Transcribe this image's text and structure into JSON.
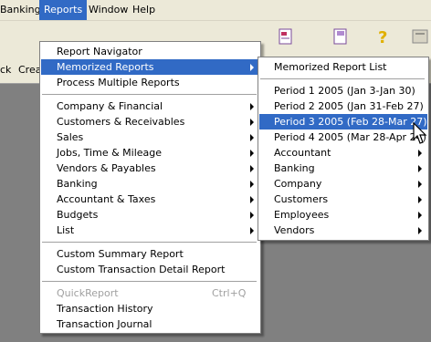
{
  "menubar": {
    "items": [
      {
        "label": "Banking"
      },
      {
        "label": "Reports"
      },
      {
        "label": "Window"
      },
      {
        "label": "Help"
      }
    ]
  },
  "toolbar": {
    "left_text_1": "ck",
    "left_text_2": "Crea"
  },
  "reports_menu": {
    "items": [
      {
        "label": "Report Navigator"
      },
      {
        "label": "Memorized Reports"
      },
      {
        "label": "Process Multiple Reports"
      },
      {
        "label": "Company & Financial"
      },
      {
        "label": "Customers & Receivables"
      },
      {
        "label": "Sales"
      },
      {
        "label": "Jobs, Time & Mileage"
      },
      {
        "label": "Vendors & Payables"
      },
      {
        "label": "Banking"
      },
      {
        "label": "Accountant & Taxes"
      },
      {
        "label": "Budgets"
      },
      {
        "label": "List"
      },
      {
        "label": "Custom Summary Report"
      },
      {
        "label": "Custom Transaction Detail Report"
      },
      {
        "label": "QuickReport",
        "shortcut": "Ctrl+Q"
      },
      {
        "label": "Transaction History"
      },
      {
        "label": "Transaction Journal"
      }
    ]
  },
  "memorized_menu": {
    "items": [
      {
        "label": "Memorized Report List"
      },
      {
        "label": "Period 1 2005 (Jan 3-Jan 30)"
      },
      {
        "label": "Period 2 2005 (Jan 31-Feb 27)"
      },
      {
        "label": "Period 3 2005 (Feb 28-Mar 27)"
      },
      {
        "label": "Period 4 2005 (Mar 28-Apr 24)"
      },
      {
        "label": "Accountant"
      },
      {
        "label": "Banking"
      },
      {
        "label": "Company"
      },
      {
        "label": "Customers"
      },
      {
        "label": "Employees"
      },
      {
        "label": "Vendors"
      }
    ]
  },
  "colors": {
    "highlight": "#316ac5",
    "menubar_bg": "#ece9d8",
    "workspace_bg": "#808080"
  }
}
